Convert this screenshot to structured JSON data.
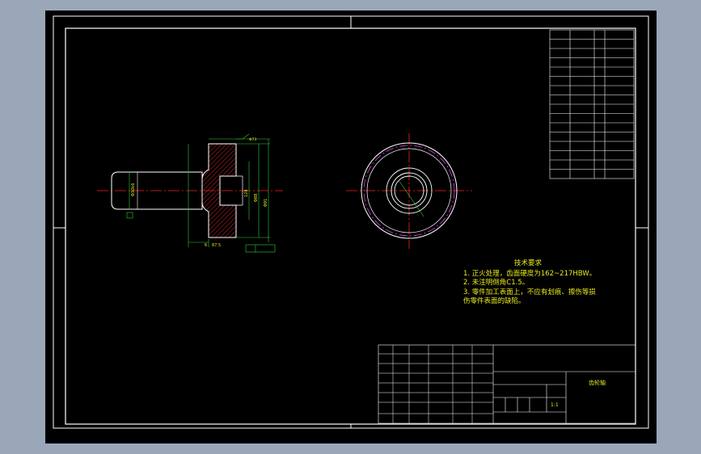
{
  "drawing": {
    "scale": "1:1",
    "part_name": "齿轮轴",
    "colors": {
      "background": "#9aa7b8",
      "sheet": "#000000",
      "border": "#ffffff",
      "table_line": "#ffffff",
      "annotation": "#e8e81e",
      "dimension": "#32cd32",
      "centerline": "#ff2020",
      "outline": "#ffffff",
      "hatch": "#ff3030",
      "pitch_circle": "#e040e0"
    }
  },
  "technical_requirements": {
    "title": "技术要求",
    "items": [
      "1. 正火处理，齿面硬度为162~217HBW。",
      "2. 未注明倒角C1.5。",
      "3. 零件加工表面上，不应有划痕、擦伤等损",
      "伤零件表面的缺陷。"
    ]
  },
  "side_view": {
    "dimensions": [
      "Φ30k6",
      "87.5",
      "Φ73",
      "Φ91",
      "Φ88",
      "6",
      "128"
    ]
  }
}
